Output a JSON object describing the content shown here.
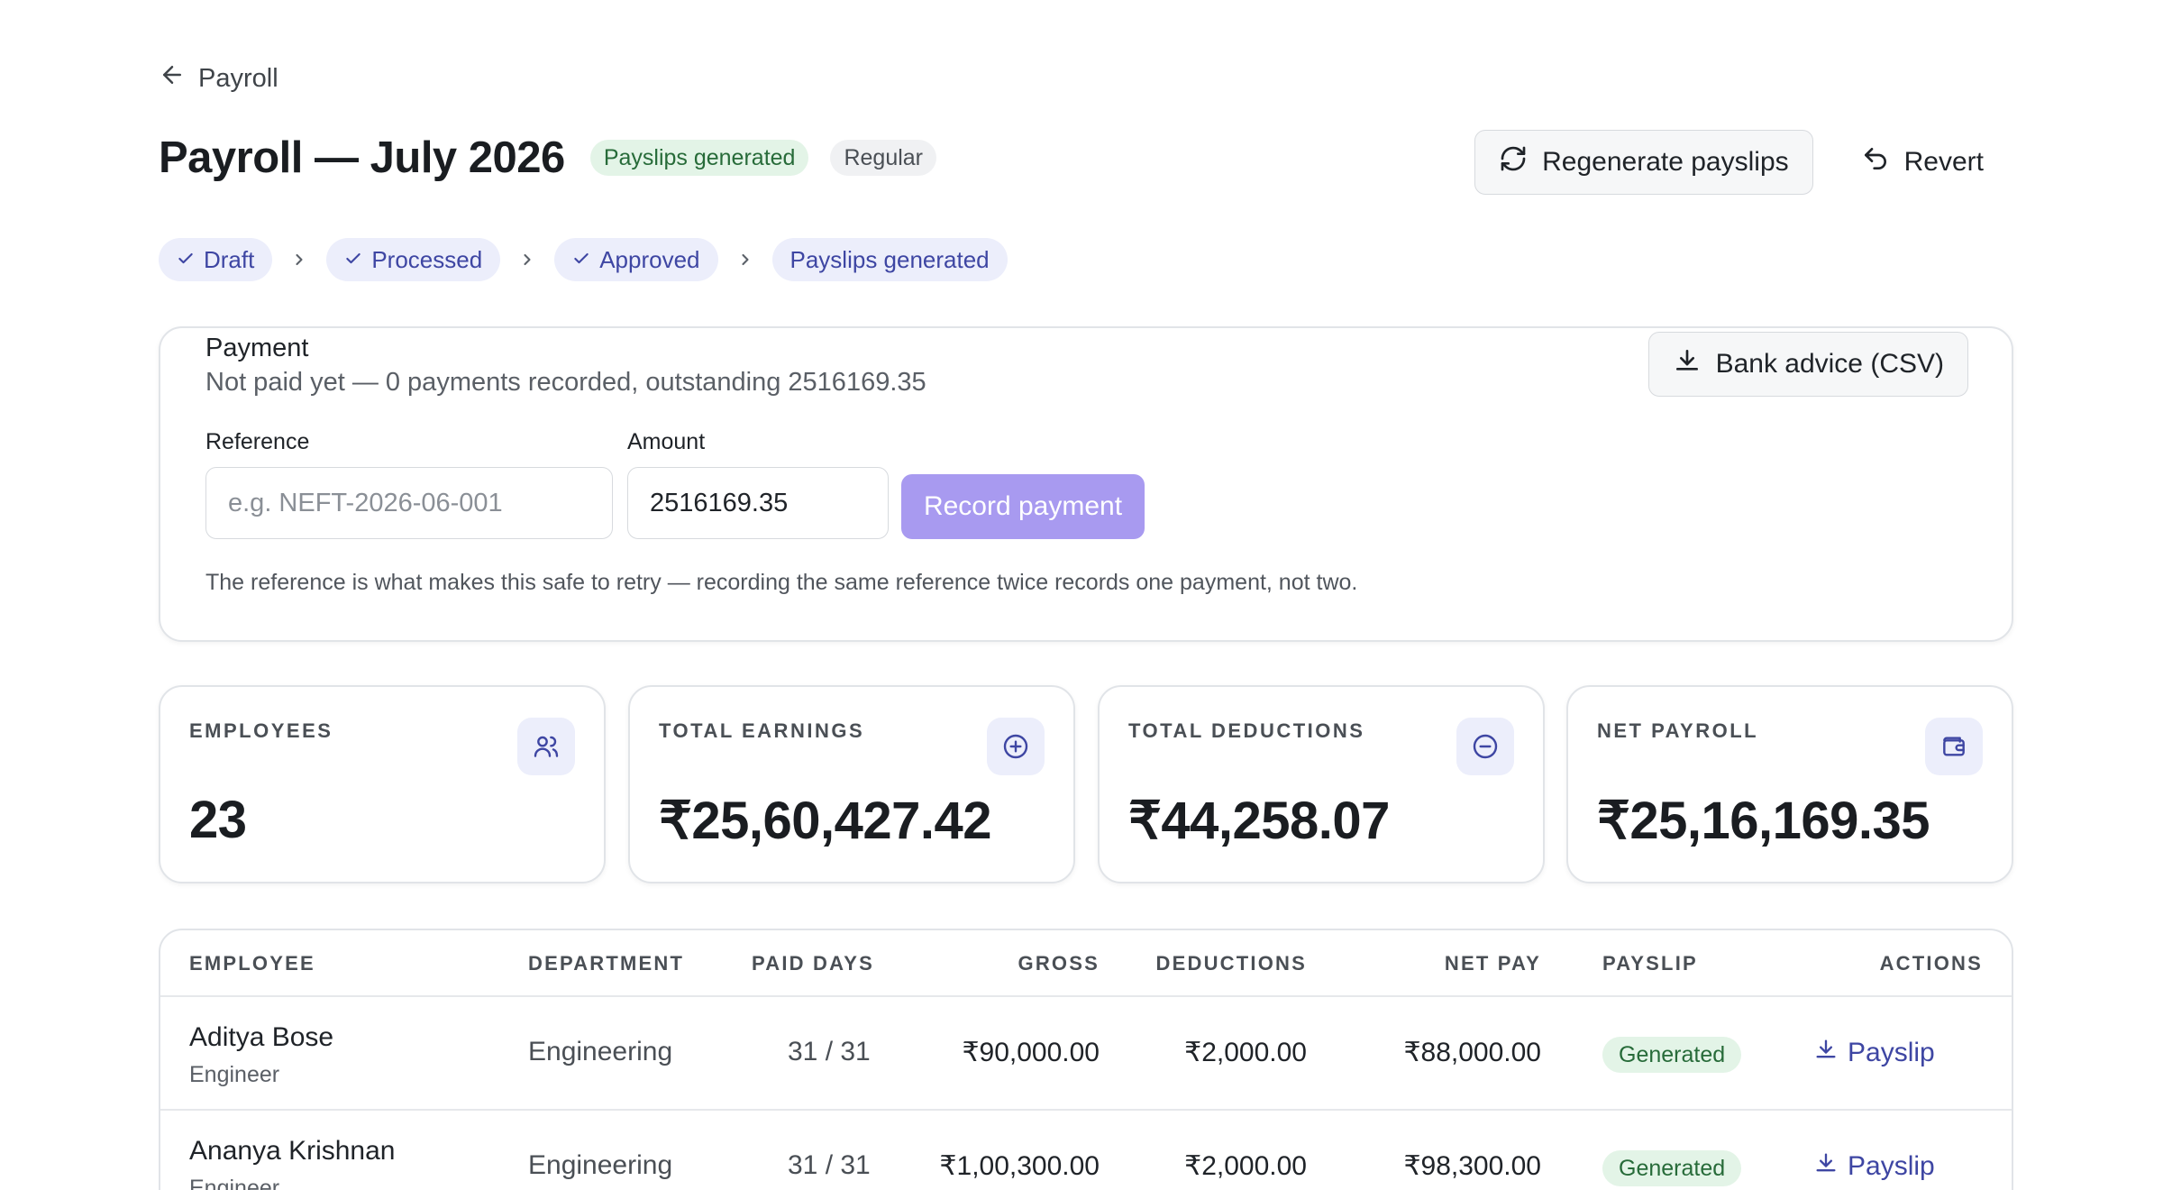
{
  "breadcrumb": {
    "back_label": "Payroll"
  },
  "header": {
    "title": "Payroll — July 2026",
    "status_badge": "Payslips generated",
    "type_badge": "Regular",
    "regenerate_label": "Regenerate payslips",
    "revert_label": "Revert"
  },
  "steps": [
    {
      "label": "Draft",
      "done": true
    },
    {
      "label": "Processed",
      "done": true
    },
    {
      "label": "Approved",
      "done": true
    },
    {
      "label": "Payslips generated",
      "done": false
    }
  ],
  "payment": {
    "title": "Payment",
    "status_text": "Not paid yet — 0 payments recorded, outstanding 2516169.35",
    "bank_advice_label": "Bank advice (CSV)",
    "reference_label": "Reference",
    "reference_placeholder": "e.g. NEFT-2026-06-001",
    "reference_value": "",
    "amount_label": "Amount",
    "amount_value": "2516169.35",
    "record_label": "Record payment",
    "hint": "The reference is what makes this safe to retry — recording the same reference twice records one payment, not two."
  },
  "stats": [
    {
      "label": "EMPLOYEES",
      "value": "23",
      "icon": "users-icon"
    },
    {
      "label": "TOTAL EARNINGS",
      "value": "₹25,60,427.42",
      "icon": "plus-circle-icon"
    },
    {
      "label": "TOTAL DEDUCTIONS",
      "value": "₹44,258.07",
      "icon": "minus-circle-icon"
    },
    {
      "label": "NET PAYROLL",
      "value": "₹25,16,169.35",
      "icon": "wallet-icon"
    }
  ],
  "table": {
    "columns": [
      "EMPLOYEE",
      "DEPARTMENT",
      "PAID DAYS",
      "GROSS",
      "DEDUCTIONS",
      "NET PAY",
      "PAYSLIP",
      "ACTIONS"
    ],
    "rows": [
      {
        "name": "Aditya Bose",
        "role": "Engineer",
        "department": "Engineering",
        "paid_days": "31 / 31",
        "gross": "₹90,000.00",
        "deductions": "₹2,000.00",
        "net_pay": "₹88,000.00",
        "payslip_status": "Generated",
        "action": "Payslip"
      },
      {
        "name": "Ananya Krishnan",
        "role": "Engineer",
        "department": "Engineering",
        "paid_days": "31 / 31",
        "gross": "₹1,00,300.00",
        "deductions": "₹2,000.00",
        "net_pay": "₹98,300.00",
        "payslip_status": "Generated",
        "action": "Payslip"
      }
    ]
  },
  "colors": {
    "accent": "#3e46a3",
    "accent_soft": "#eceefb",
    "success_bg": "#e3f4e7",
    "success_text": "#276b39",
    "record_button": "#a89af0"
  }
}
